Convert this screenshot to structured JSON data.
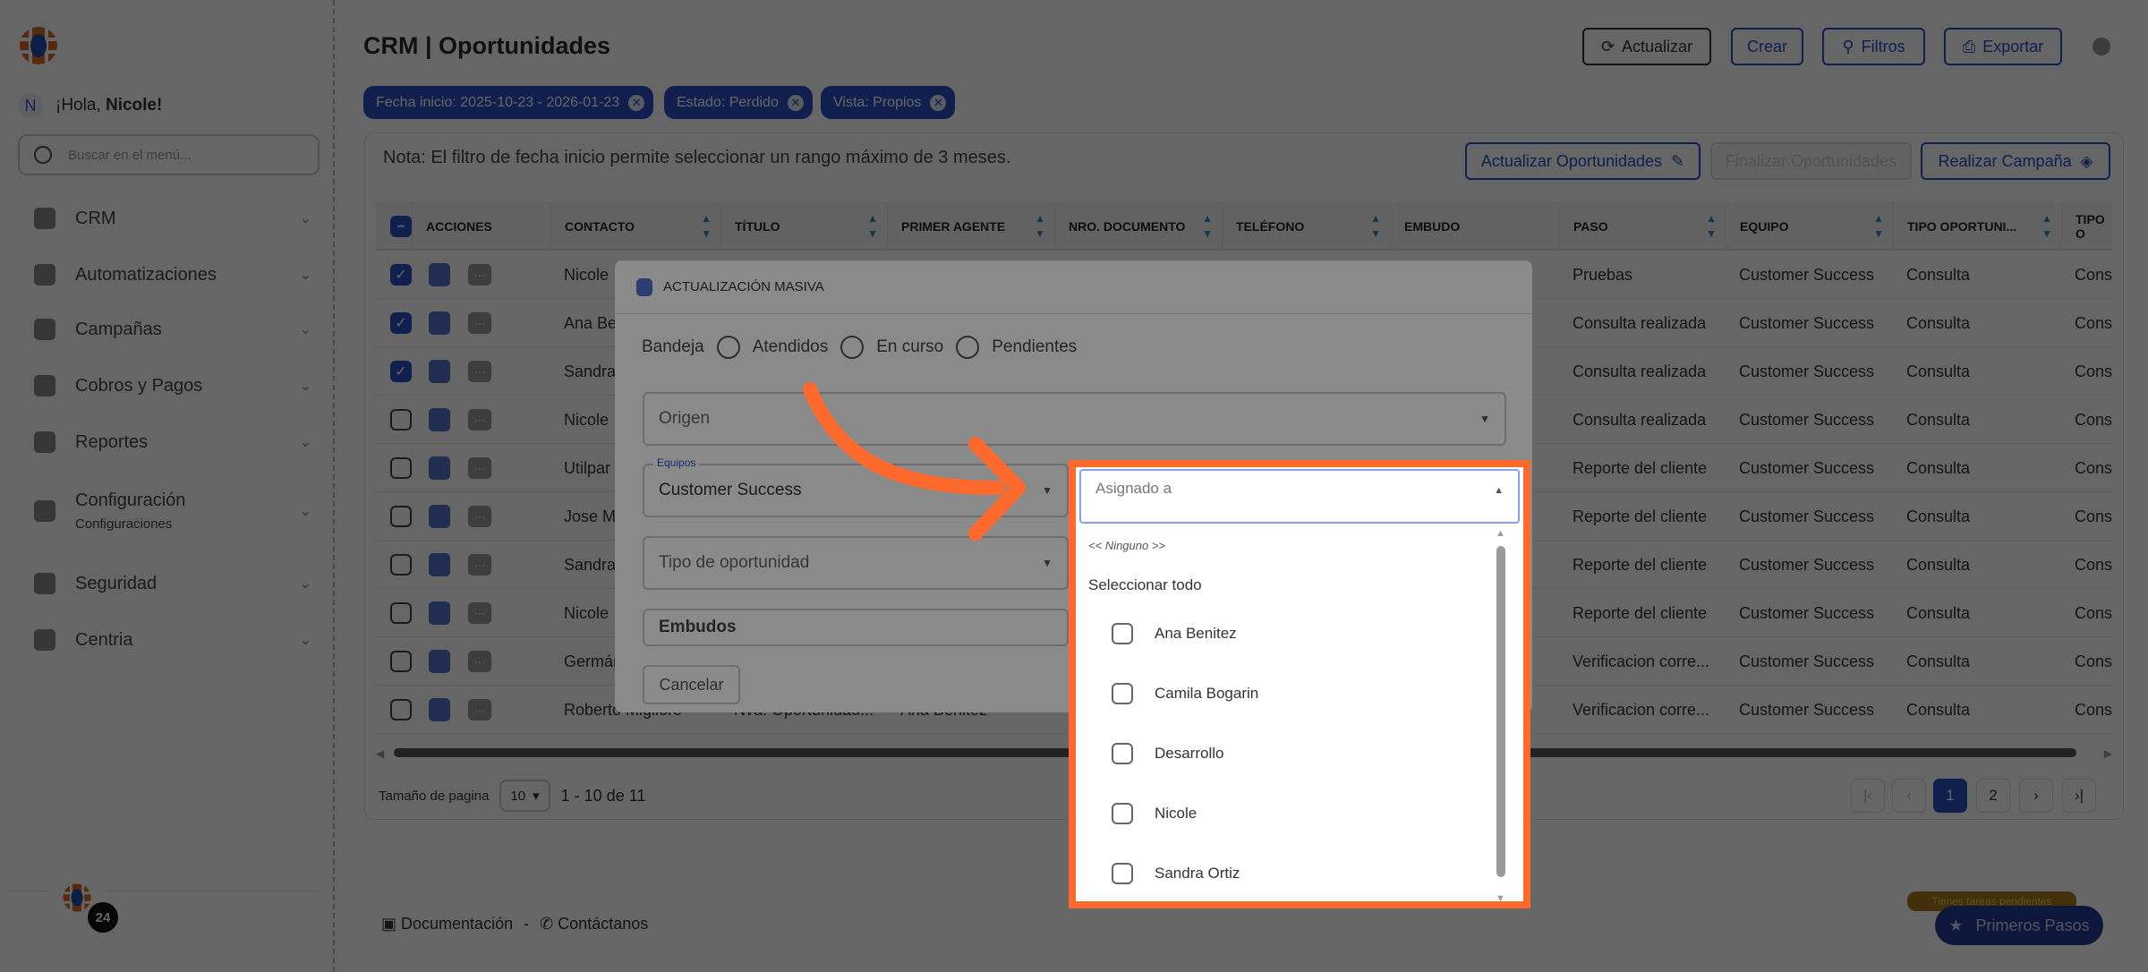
{
  "sidebar": {
    "greeting_prefix": "¡Hola, ",
    "user_name": "Nicole",
    "greeting_suffix": "!",
    "avatar_initial": "N",
    "search_placeholder": "Buscar en el menú...",
    "items": [
      {
        "label": "CRM",
        "icon": "document-icon"
      },
      {
        "label": "Automatizaciones",
        "icon": "hexagon-icon"
      },
      {
        "label": "Campañas",
        "icon": "broadcast-icon"
      },
      {
        "label": "Cobros y Pagos",
        "icon": "id-card-icon"
      },
      {
        "label": "Reportes",
        "icon": "wallet-icon"
      },
      {
        "label": "Configuración",
        "sub": "Configuraciones",
        "icon": "book-icon"
      },
      {
        "label": "Seguridad",
        "icon": "shield-icon"
      },
      {
        "label": "Centria",
        "icon": "shield-icon"
      }
    ],
    "notification_count": "24"
  },
  "header": {
    "title": "CRM | Oportunidades",
    "buttons": {
      "refresh": "Actualizar",
      "create": "Crear",
      "filters": "Filtros",
      "export": "Exportar"
    }
  },
  "filters": [
    "Fecha inicio: 2025-10-23 - 2026-01-23",
    "Estado: Perdido",
    "Vista: Propios"
  ],
  "card": {
    "note": "Nota: El filtro de fecha inicio permite seleccionar un rango máximo de 3 meses.",
    "buttons": {
      "update": "Actualizar Oportunidades",
      "finish": "Finalizar Oportunidades",
      "campaign": "Realizar Campaña"
    }
  },
  "table": {
    "columns": [
      "ACCIONES",
      "CONTACTO",
      "TÍTULO",
      "PRIMER AGENTE",
      "NRO. DOCUMENTO",
      "TELÉFONO",
      "EMBUDO",
      "PASO",
      "EQUIPO",
      "TIPO OPORTUNI...",
      "TIPO O"
    ],
    "rows": [
      {
        "checked": true,
        "contacto": "Nicole",
        "titulo": "",
        "agente": "",
        "paso": "Pruebas",
        "equipo": "Customer Success",
        "tipo_op": "Consulta",
        "tipo": "Cons"
      },
      {
        "checked": true,
        "contacto": "Ana Be",
        "titulo": "",
        "agente": "",
        "paso": "Consulta realizada",
        "equipo": "Customer Success",
        "tipo_op": "Consulta",
        "tipo": "Cons"
      },
      {
        "checked": true,
        "contacto": "Sandra",
        "titulo": "",
        "agente": "",
        "paso": "Consulta realizada",
        "equipo": "Customer Success",
        "tipo_op": "Consulta",
        "tipo": "Cons"
      },
      {
        "checked": false,
        "contacto": "Nicole",
        "titulo": "",
        "agente": "",
        "paso": "Consulta realizada",
        "equipo": "Customer Success",
        "tipo_op": "Consulta",
        "tipo": "Cons"
      },
      {
        "checked": false,
        "contacto": "Utilpar",
        "titulo": "",
        "agente": "",
        "paso": "Reporte del cliente",
        "equipo": "Customer Success",
        "tipo_op": "Consulta",
        "tipo": "Cons"
      },
      {
        "checked": false,
        "contacto": "Jose M",
        "titulo": "",
        "agente": "",
        "paso": "Reporte del cliente",
        "equipo": "Customer Success",
        "tipo_op": "Consulta",
        "tipo": "Cons"
      },
      {
        "checked": false,
        "contacto": "Sandra",
        "titulo": "",
        "agente": "",
        "paso": "Reporte del cliente",
        "equipo": "Customer Success",
        "tipo_op": "Consulta",
        "tipo": "Cons"
      },
      {
        "checked": false,
        "contacto": "Nicole",
        "titulo": "",
        "agente": "",
        "paso": "Reporte del cliente",
        "equipo": "Customer Success",
        "tipo_op": "Consulta",
        "tipo": "Cons"
      },
      {
        "checked": false,
        "contacto": "Germán",
        "titulo": "",
        "agente": "",
        "paso": "Verificacion corre...",
        "equipo": "Customer Success",
        "tipo_op": "Consulta",
        "tipo": "Cons"
      },
      {
        "checked": false,
        "contacto": "Roberto Migliore",
        "titulo": "Nva. Oportunidad...",
        "agente": "Ana Benitez",
        "paso": "Verificacion corre...",
        "equipo": "Customer Success",
        "tipo_op": "Consulta",
        "tipo": "Cons"
      }
    ]
  },
  "pagination": {
    "size_label": "Tamaño de pagina",
    "size": "10",
    "range": "1 - 10 de 11",
    "pages": [
      "1",
      "2"
    ],
    "current": "1"
  },
  "footer": {
    "docs": "Documentación",
    "sep": "-",
    "contact": "Contáctanos"
  },
  "modal": {
    "title": "ACTUALIZACIÓN MASIVA",
    "bandeja_label": "Bandeja",
    "bandeja_options": [
      "Atendidos",
      "En curso",
      "Pendientes"
    ],
    "origen_placeholder": "Origen",
    "equipos_label": "Equipos",
    "equipos_value": "Customer Success",
    "tipo_placeholder": "Tipo de oportunidad",
    "embudos_label": "Embudos",
    "cancel": "Cancelar",
    "assigned": {
      "label": "Asignado a",
      "none": "<< Ninguno >>",
      "select_all": "Seleccionar todo",
      "options": [
        "Ana Benitez",
        "Camila Bogarin",
        "Desarrollo",
        "Nicole",
        "Sandra Ortiz"
      ]
    }
  },
  "widgets": {
    "tasks_badge": "Tienes tareas pendientes",
    "first_steps": "Primeros Pasos"
  },
  "colors": {
    "primary": "#2a4fc0",
    "highlight": "#ff6a2c"
  }
}
